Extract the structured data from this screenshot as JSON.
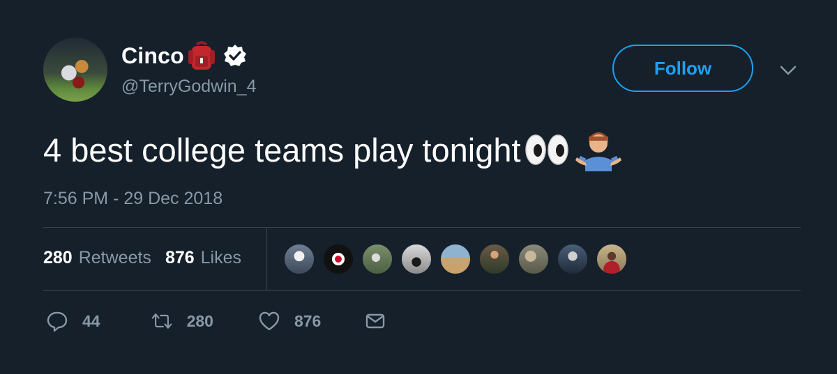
{
  "user": {
    "display_name": "Cinco",
    "handle": "@TerryGodwin_4",
    "name_emoji": "backpack-icon",
    "verified": true
  },
  "follow_label": "Follow",
  "tweet": {
    "text": "4 best college teams play tonight",
    "emojis": [
      "eyes-icon",
      "person-shrugging-icon"
    ],
    "timestamp": "7:56 PM - 29 Dec 2018"
  },
  "stats": {
    "retweets_count": "280",
    "retweets_label": "Retweets",
    "likes_count": "876",
    "likes_label": "Likes"
  },
  "actions": {
    "reply_count": "44",
    "retweet_count": "280",
    "like_count": "876"
  },
  "colors": {
    "background": "#15202b",
    "accent": "#1da1f2",
    "secondary_text": "#8899a6",
    "divider": "#38444d"
  }
}
